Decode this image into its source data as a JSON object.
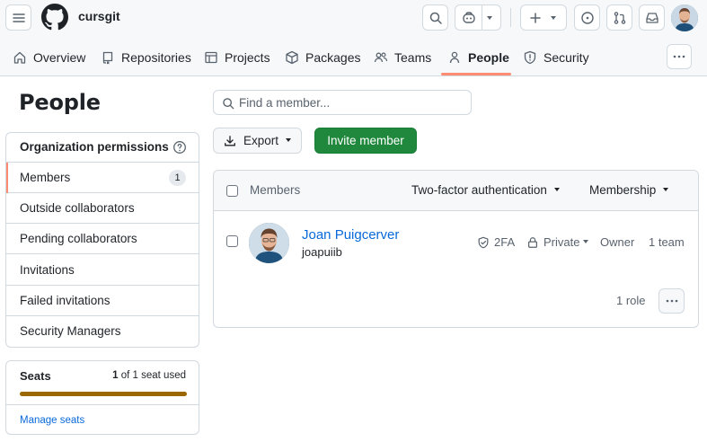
{
  "header": {
    "org_name": "cursgit",
    "tabs": [
      {
        "label": "Overview",
        "icon": "home-icon"
      },
      {
        "label": "Repositories",
        "icon": "repo-icon"
      },
      {
        "label": "Projects",
        "icon": "table-icon"
      },
      {
        "label": "Packages",
        "icon": "package-icon"
      },
      {
        "label": "Teams",
        "icon": "people-icon"
      },
      {
        "label": "People",
        "icon": "person-icon",
        "active": true
      },
      {
        "label": "Security",
        "icon": "shield-icon"
      }
    ]
  },
  "sidebar": {
    "title": "People",
    "heading": "Organization permissions",
    "items": [
      {
        "label": "Members",
        "count": "1",
        "selected": true
      },
      {
        "label": "Outside collaborators"
      },
      {
        "label": "Pending collaborators"
      },
      {
        "label": "Invitations"
      },
      {
        "label": "Failed invitations"
      },
      {
        "label": "Security Managers"
      }
    ],
    "seats": {
      "title": "Seats",
      "used": "1",
      "used_suffix": "of 1 seat used",
      "fill_fraction": 1.0,
      "bar_color": "#9a6700",
      "manage_label": "Manage seats"
    }
  },
  "main": {
    "search_placeholder": "Find a member...",
    "export_label": "Export",
    "invite_label": "Invite member",
    "table": {
      "col_members": "Members",
      "col_2fa": "Two-factor authentication",
      "col_membership": "Membership",
      "rows": [
        {
          "name": "Joan Puigcerver",
          "login": "joapuiib",
          "twofa": "2FA",
          "visibility": "Private",
          "role": "Owner",
          "teams": "1 team",
          "roles": "1 role"
        }
      ]
    }
  },
  "colors": {
    "accent_underline": "#fd8c73",
    "primary_button": "#1f883d",
    "link": "#0969da"
  }
}
